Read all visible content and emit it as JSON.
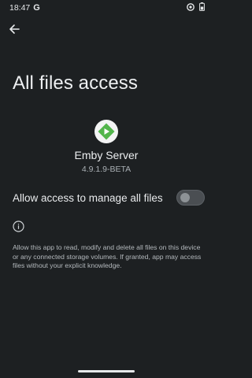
{
  "status_bar": {
    "time": "18:47",
    "google_glyph": "G",
    "icons": [
      "g-notification-icon",
      "wifi-icon",
      "battery-icon"
    ]
  },
  "header": {
    "back_icon": "arrow-back-icon",
    "title": "All files access"
  },
  "app": {
    "icon": "emby-play-icon",
    "name": "Emby Server",
    "version": "4.9.1.9-BETA",
    "brand_color": "#52b54b"
  },
  "toggle": {
    "label": "Allow access to manage all files",
    "state": "off"
  },
  "info": {
    "icon": "info-icon",
    "description": "Allow this app to read, modify and delete all files on this device or any connected storage volumes. If granted, app may access files without your explicit knowledge."
  }
}
